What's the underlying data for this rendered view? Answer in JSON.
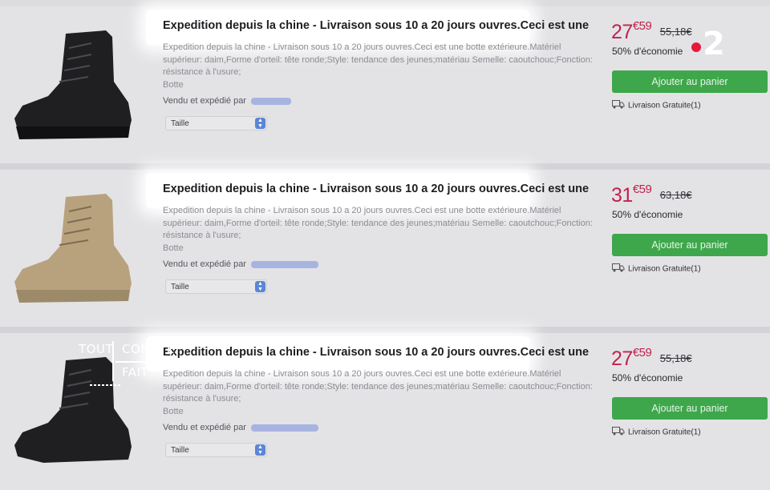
{
  "products": [
    {
      "title": "Expedition depuis la chine - Livraison sous 10 a 20 jours ouvres.Ceci est une",
      "description": "Expedition depuis la chine - Livraison sous 10 a 20 jours ouvres.Ceci est une botte extérieure.Matériel supérieur: daim,Forme d'orteil: tête ronde;Style: tendance des jeunes;matériau Semelle: caoutchouc;Fonction: résistance à l'usure;",
      "category": "Botte",
      "vendor_label": "Vendu et expédié par",
      "size_label": "Taille",
      "price_whole": "27",
      "price_cents": "€59",
      "price_old": "55,18€",
      "saving": "50% d'économie",
      "cart_label": "Ajouter au panier",
      "delivery": "Livraison Gratuite",
      "delivery_count": "(1)",
      "boot_color": "#1f1f22"
    },
    {
      "title": "Expedition depuis la chine - Livraison sous 10 a 20 jours ouvres.Ceci est une",
      "description": "Expedition depuis la chine - Livraison sous 10 a 20 jours ouvres.Ceci est une botte extérieure.Matériel supérieur: daim,Forme d'orteil: tête ronde;Style: tendance des jeunes;matériau Semelle: caoutchouc;Fonction: résistance à l'usure;",
      "category": "Botte",
      "vendor_label": "Vendu et expédié par",
      "size_label": "Taille",
      "price_whole": "31",
      "price_cents": "€59",
      "price_old": "63,18€",
      "saving": "50% d'économie",
      "cart_label": "Ajouter au panier",
      "delivery": "Livraison Gratuite",
      "delivery_count": "(1)",
      "boot_color": "#b8a27e"
    },
    {
      "title": "Expedition depuis la chine - Livraison sous 10 a 20 jours ouvres.Ceci est une",
      "description": "Expedition depuis la chine - Livraison sous 10 a 20 jours ouvres.Ceci est une botte extérieure.Matériel supérieur: daim,Forme d'orteil: tête ronde;Style: tendance des jeunes;matériau Semelle: caoutchouc;Fonction: résistance à l'usure;",
      "category": "Botte",
      "vendor_label": "Vendu et expédié par",
      "size_label": "Taille",
      "price_whole": "27",
      "price_cents": "€59",
      "price_old": "55,18€",
      "saving": "50% d'économie",
      "cart_label": "Ajouter au panier",
      "delivery": "Livraison Gratuite",
      "delivery_count": "(1)",
      "boot_color": "#1f1f22"
    }
  ],
  "overlay": {
    "channel": "2",
    "channel_dot_color": "#e5193c",
    "show_word_1": "TOUT",
    "show_word_2": "COMPTE",
    "show_word_3": "FAIT"
  }
}
